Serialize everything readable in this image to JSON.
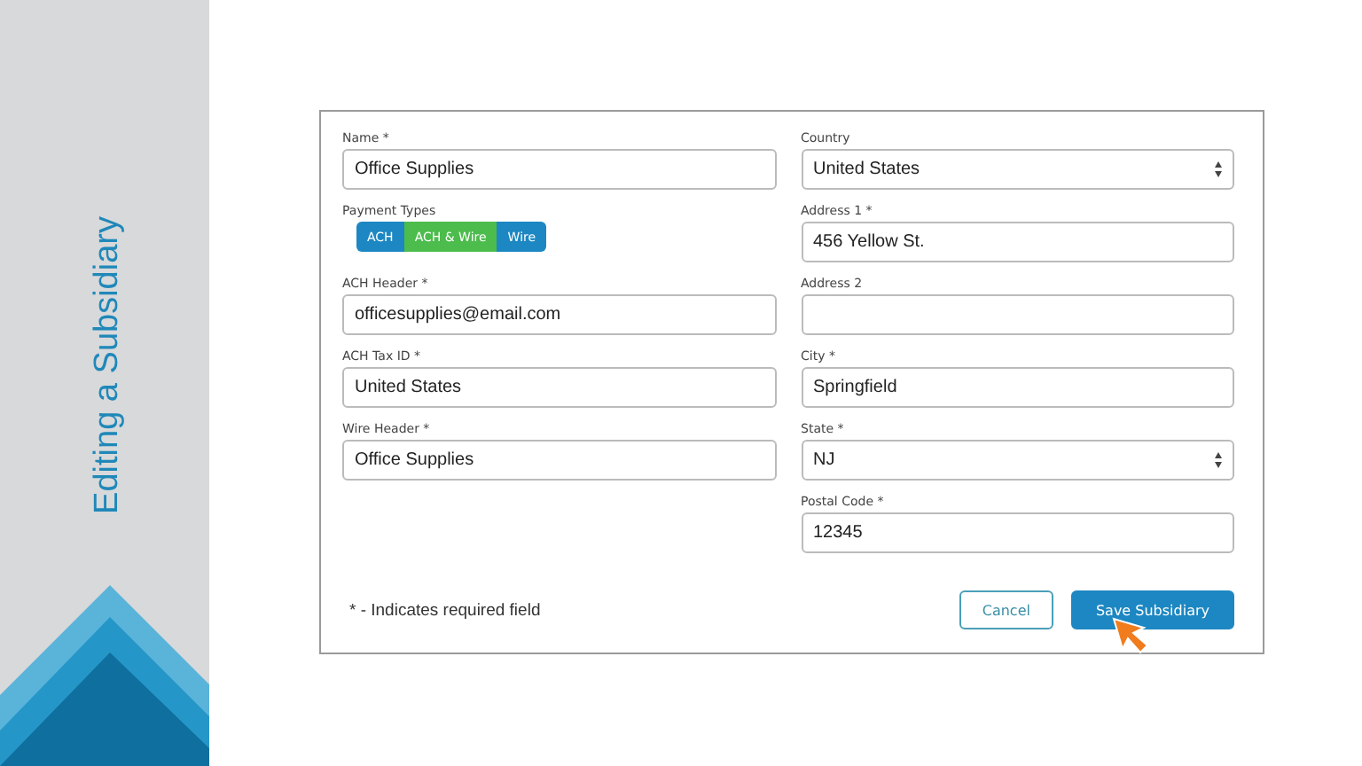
{
  "sidebar": {
    "title": "Editing a Subsidiary"
  },
  "form": {
    "left": [
      {
        "kind": "input",
        "label": "Name *",
        "value": "Office Supplies"
      },
      {
        "kind": "toggle",
        "label": "Payment Types",
        "options": [
          {
            "label": "ACH",
            "selected": false
          },
          {
            "label": "ACH & Wire",
            "selected": true
          },
          {
            "label": "Wire",
            "selected": false
          }
        ]
      },
      {
        "kind": "input",
        "label": "ACH Header *",
        "value": "officesupplies@email.com"
      },
      {
        "kind": "input",
        "label": "ACH Tax ID *",
        "value": "United States"
      },
      {
        "kind": "input",
        "label": "Wire Header *",
        "value": "Office Supplies"
      }
    ],
    "right": [
      {
        "kind": "select",
        "label": "Country",
        "value": "United States"
      },
      {
        "kind": "input",
        "label": "Address 1 *",
        "value": "456 Yellow St."
      },
      {
        "kind": "input",
        "label": "Address 2"
      },
      {
        "kind": "input",
        "label": "City *",
        "value": "Springfield"
      },
      {
        "kind": "select",
        "label": "State *",
        "value": "NJ"
      },
      {
        "kind": "input",
        "label": "Postal Code *",
        "value": "12345"
      }
    ],
    "note": "* - Indicates required field",
    "buttons": [
      {
        "kind": "secondary",
        "label": "Cancel"
      },
      {
        "kind": "primary",
        "label": "Save Subsidiary"
      }
    ]
  }
}
